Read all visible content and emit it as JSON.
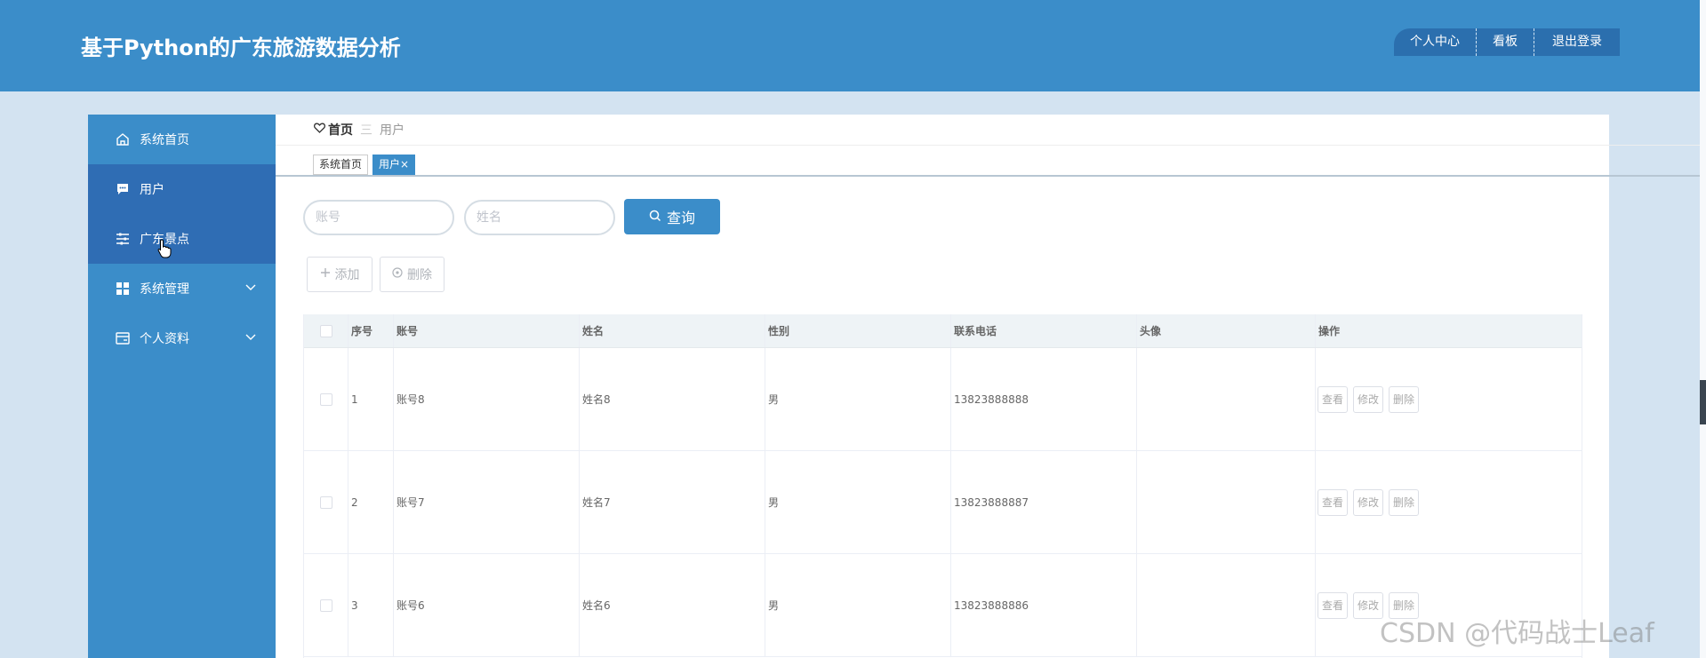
{
  "header": {
    "title": "基于Python的广东旅游数据分析",
    "nav": [
      "个人中心",
      "看板",
      "退出登录"
    ]
  },
  "sidebar": {
    "items": [
      {
        "label": "系统首页",
        "icon": "home-icon"
      },
      {
        "label": "用户",
        "icon": "chat-icon"
      },
      {
        "label": "广东景点",
        "icon": "sliders-icon"
      },
      {
        "label": "系统管理",
        "icon": "grid-icon"
      },
      {
        "label": "个人资料",
        "icon": "card-icon"
      }
    ]
  },
  "breadcrumb": {
    "home": "首页",
    "separator": "三",
    "current": "用户"
  },
  "tabs": [
    {
      "label": "系统首页"
    },
    {
      "label": "用户",
      "close": "×"
    }
  ],
  "search": {
    "account_placeholder": "账号",
    "name_placeholder": "姓名",
    "query_label": "查询"
  },
  "actions": {
    "add_label": "添加",
    "delete_label": "删除"
  },
  "table": {
    "columns": [
      "序号",
      "账号",
      "姓名",
      "性别",
      "联系电话",
      "头像",
      "操作"
    ],
    "rows": [
      {
        "no": "1",
        "account": "账号8",
        "name": "姓名8",
        "sex": "男",
        "phone": "13823888888"
      },
      {
        "no": "2",
        "account": "账号7",
        "name": "姓名7",
        "sex": "男",
        "phone": "13823888887"
      },
      {
        "no": "3",
        "account": "账号6",
        "name": "姓名6",
        "sex": "男",
        "phone": "13823888886"
      }
    ],
    "row_ops": [
      "查看",
      "修改",
      "删除"
    ]
  },
  "watermark": "CSDN @代码战士Leaf",
  "colors": {
    "primary": "#3b8dc9",
    "active_menu": "#2f6db4",
    "background": "#d3e3f1"
  }
}
